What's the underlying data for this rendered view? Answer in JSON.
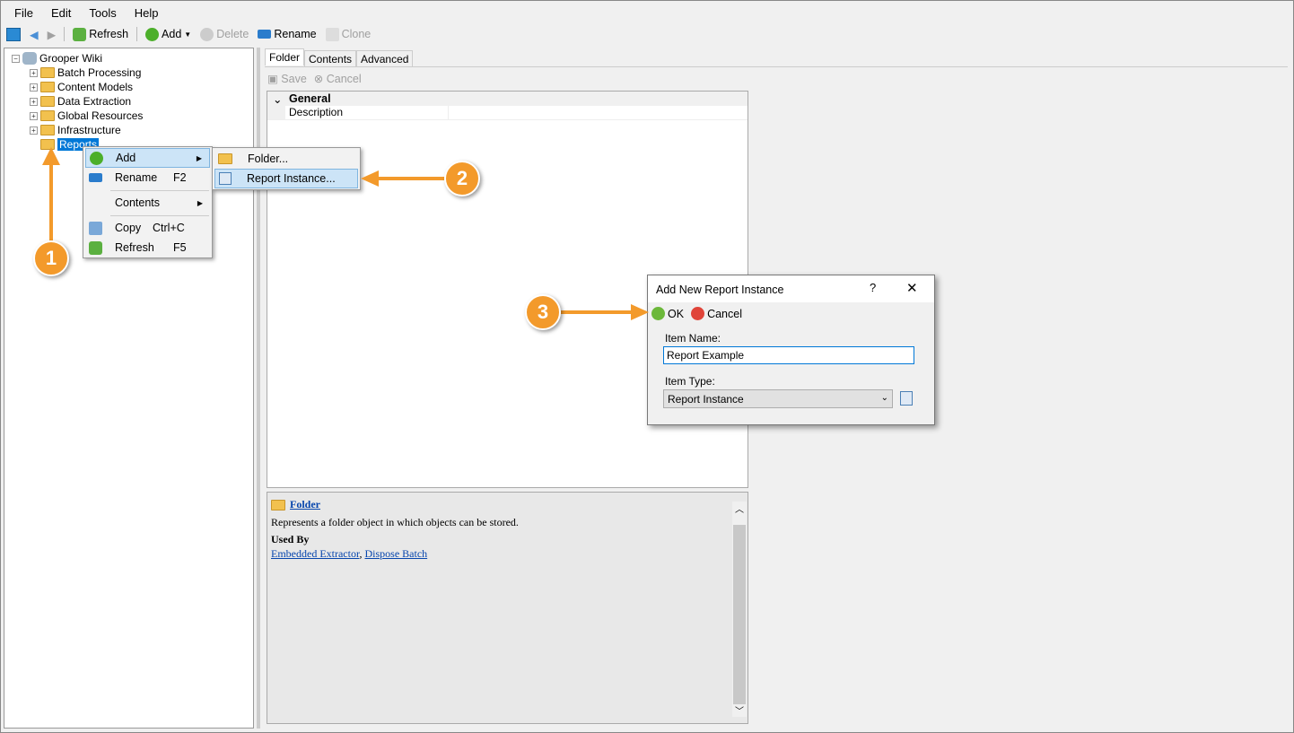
{
  "menubar": [
    "File",
    "Edit",
    "Tools",
    "Help"
  ],
  "toolbar": {
    "refresh": "Refresh",
    "add": "Add",
    "delete": "Delete",
    "rename": "Rename",
    "clone": "Clone"
  },
  "tree": {
    "root": "Grooper Wiki",
    "children": [
      "Batch Processing",
      "Content Models",
      "Data Extraction",
      "Global Resources",
      "Infrastructure",
      "Reports"
    ]
  },
  "tabs": [
    "Folder",
    "Contents",
    "Advanced"
  ],
  "subtoolbar": {
    "save": "Save",
    "cancel": "Cancel"
  },
  "property_grid": {
    "category": "General",
    "rows": [
      "Description"
    ]
  },
  "help": {
    "title": "Folder",
    "description": "Represents a folder object in which objects can be stored.",
    "used_by_label": "Used By",
    "links": [
      "Embedded Extractor",
      "Dispose Batch"
    ],
    "sep": ", "
  },
  "context_menu": [
    {
      "label": "Add",
      "shortcut": ""
    },
    {
      "label": "Rename",
      "shortcut": "F2"
    },
    {
      "label": "Contents",
      "shortcut": ""
    },
    {
      "label": "Copy",
      "shortcut": "Ctrl+C"
    },
    {
      "label": "Refresh",
      "shortcut": "F5"
    }
  ],
  "submenu": [
    "Folder...",
    "Report Instance..."
  ],
  "dialog": {
    "title": "Add New Report Instance",
    "help": "?",
    "close": "✕",
    "ok": "OK",
    "cancel": "Cancel",
    "name_label": "Item Name:",
    "name_value": "Report Example",
    "type_label": "Item Type:",
    "type_value": "Report Instance"
  },
  "badges": [
    "1",
    "2",
    "3"
  ],
  "colors": {
    "accent": "#f39a2b",
    "selection": "#0078d7"
  }
}
